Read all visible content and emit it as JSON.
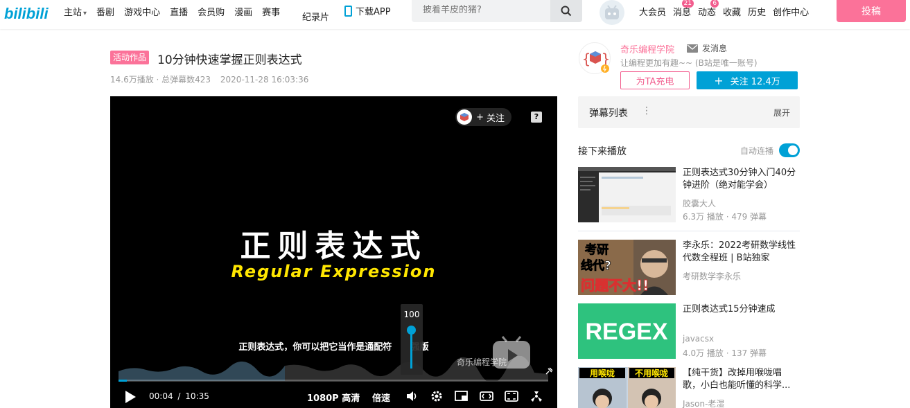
{
  "header": {
    "logo_text": "bilibili",
    "nav_items": [
      "主站",
      "番剧",
      "游戏中心",
      "直播",
      "会员购",
      "漫画",
      "赛事"
    ],
    "nav_doc": "纪录片",
    "download_label": "下载APP",
    "search_placeholder": "披着羊皮的猪?",
    "right_items": [
      {
        "label": "大会员",
        "badge": ""
      },
      {
        "label": "消息",
        "badge": "21"
      },
      {
        "label": "动态",
        "badge": "6"
      },
      {
        "label": "收藏",
        "badge": ""
      },
      {
        "label": "历史",
        "badge": ""
      },
      {
        "label": "创作中心",
        "badge": ""
      }
    ],
    "upload_label": "投稿"
  },
  "video": {
    "activity_tag": "活动作品",
    "title": "10分钟快速掌握正则表达式",
    "meta": "14.6万播放 · 总弹幕数423",
    "pubdate": "2020-11-28 16:03:36"
  },
  "player": {
    "follow_label": "关注",
    "help_icon": "?",
    "title_cn": "正则表达式",
    "title_en": "Regular Expression",
    "subtitle": "正则表达式，你可以把它当作是通配符      强版",
    "volume": "100",
    "watermark": "奇乐编程学院",
    "progress_fraction": 0.006,
    "time_current": "00:04",
    "time_separator": "/",
    "time_total": "10:35",
    "quality": "1080P 高清",
    "speed": "倍速"
  },
  "uploader": {
    "name": "奇乐编程学院",
    "send_message": "发消息",
    "description": "让编程更加有趣~~ (B站是唯一账号)",
    "charge_label": "为TA充电",
    "follow_label": "关注 12.4万"
  },
  "danmaku": {
    "title": "弹幕列表",
    "menu_icon": "⋮",
    "expand": "展开"
  },
  "next_up": {
    "label": "接下来播放",
    "autoplay_label": "自动连播"
  },
  "recommendations": [
    {
      "title": "正则表达式30分钟入门40分钟进阶（绝对能学会）",
      "author": "胶囊大人",
      "stats": "6.3万 播放 · 479 弹幕"
    },
    {
      "title": "李永乐：2022考研数学线性代数全程班 | B站独家",
      "author": "考研数学李永乐",
      "stats": "",
      "thumb_text_1": "考研",
      "thumb_text_2": "线代?",
      "thumb_text_3": "问题不大!!"
    },
    {
      "title": "正则表达式15分钟速成",
      "author": "javacsx",
      "stats": "4.0万 播放 · 137 弹幕",
      "thumb_text": "REGEX"
    },
    {
      "title": "【纯干货】改掉用喉咙唱歌，小白也能听懂的科学...",
      "author": "Jason-老湿",
      "stats": "",
      "thumb_text_1": "用喉咙",
      "thumb_text_2": "不用喉咙"
    }
  ],
  "colors": {
    "brand_blue": "#00a1d6",
    "brand_pink": "#fb7299"
  }
}
